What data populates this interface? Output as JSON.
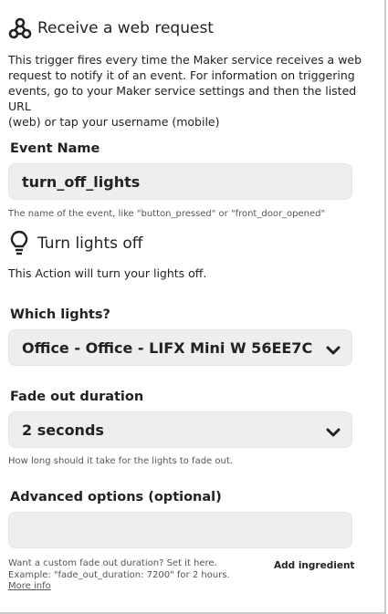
{
  "trigger": {
    "icon": "maker-webhook-icon",
    "title": "Receive a web request",
    "description_lines": [
      "This trigger fires every time the Maker service receives a web",
      "request to notify it of an event. For information on triggering",
      "events, go to your Maker service settings and then the listed URL",
      "(web) or tap your username (mobile)"
    ]
  },
  "event_name": {
    "label": "Event Name",
    "value": "turn_off_lights",
    "hint": "The name of the event, like \"button_pressed\" or \"front_door_opened\""
  },
  "action": {
    "icon": "lightbulb-icon",
    "title": "Turn lights off",
    "description": "This Action will turn your lights off."
  },
  "which_lights": {
    "label": "Which lights?",
    "selected": "Office - Office - LIFX Mini W 56EE7C"
  },
  "fade_out": {
    "label": "Fade out duration",
    "selected": "2 seconds",
    "hint": "How long should it take for the lights to fade out."
  },
  "advanced": {
    "label": "Advanced options (optional)",
    "value": "",
    "hint_lines": [
      "Want a custom fade out duration? Set it here.",
      "Example: \"fade_out_duration: 7200\" for 2 hours."
    ],
    "more_info": "More info",
    "add_ingredient": "Add ingredient"
  },
  "colors": {
    "field_bg": "#eeeeee",
    "text": "#222222",
    "hint": "#555555"
  }
}
